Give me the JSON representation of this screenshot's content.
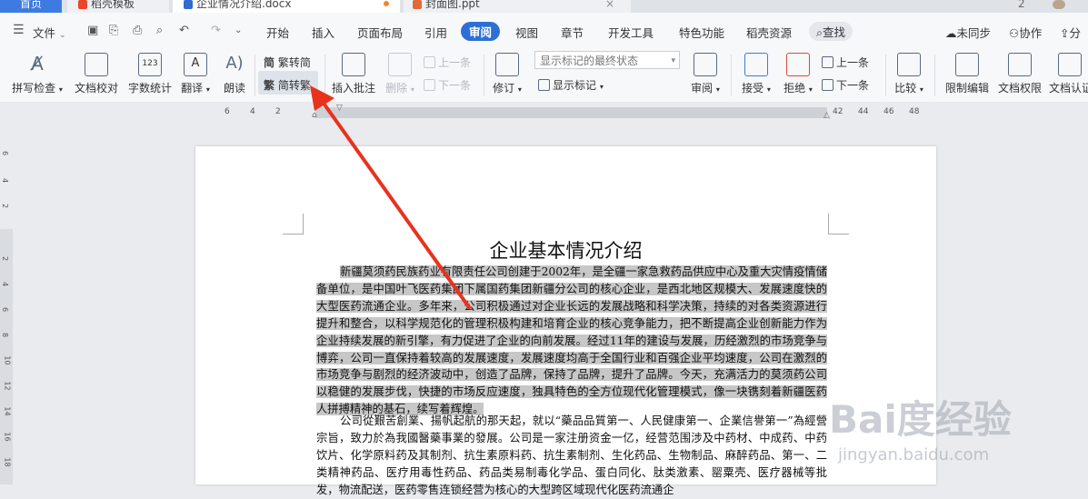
{
  "tabs": [
    {
      "label": "首页",
      "active": false
    },
    {
      "label": "稻壳模板",
      "active": false
    },
    {
      "label": "企业情况介绍.docx",
      "active": true
    },
    {
      "label": "封面图.ppt",
      "active": false
    }
  ],
  "menu": {
    "file_label": "文件",
    "items": [
      "开始",
      "插入",
      "页面布局",
      "引用",
      "审阅",
      "视图",
      "章节",
      "开发工具",
      "特色功能",
      "稻壳资源"
    ],
    "active_item": "审阅",
    "search_label": "查找",
    "sync_label": "未同步",
    "collab_label": "协作",
    "share_label": "分"
  },
  "ribbon": {
    "spell_check": "拼写检查",
    "doc_proof": "文档校对",
    "word_count": "字数统计",
    "translate": "翻译",
    "read_aloud": "朗读",
    "trad_to_simp": "繁转简",
    "simp_to_trad": "简转繁",
    "insert_comment": "插入批注",
    "delete": "删除",
    "prev_comment": "上一条",
    "next_comment": "下一条",
    "revise": "修订",
    "markup_select": "显示标记的最终状态",
    "show_markup": "显示标记",
    "review": "审阅",
    "accept": "接受",
    "reject": "拒绝",
    "prev_change": "上一条",
    "next_change": "下一条",
    "compare": "比较",
    "restrict_edit": "限制编辑",
    "doc_permission": "文档权限",
    "doc_cert": "文档认证"
  },
  "ruler": {
    "left_numbers": [
      "6",
      "4",
      "2"
    ],
    "right_numbers": [
      "42",
      "44",
      "46",
      "48"
    ],
    "vertical_numbers": [
      "6",
      "4",
      "2",
      "2",
      "4",
      "6",
      "8",
      "10",
      "12",
      "14",
      "16",
      "18"
    ]
  },
  "document": {
    "title": "企业基本情况介绍",
    "para1": "新疆莫须药民族药业有限责任公司创建于2002年，是全疆一家急救药品供应中心及重大灾情疫情储备单位，是中国叶飞医药集团下属国药集团新疆分公司的核心企业，是西北地区规模大、发展速度快的大型医药流通企业。多年来，公司积极通过对企业长远的发展战略和科学决策，持续的对各类资源进行提升和整合，以科学规范化的管理积极构建和培育企业的核心竞争能力，把不断提高企业创新能力作为企业持续发展的新引擎，有力促进了企业的向前发展。经过11年的建设与发展，历经激烈的市场竞争与博弈，公司一直保持着较高的发展速度，发展速度均高于全国行业和百强企业平均速度，公司在激烈的市场竞争与剧烈的经济波动中，创造了品牌，保持了品牌，提升了品牌。今天，充满活力的莫须药公司以稳健的发展步伐，快捷的市场反应速度，独具特色的全方位现代化管理模式，像一块镌刻着新疆医药人拼搏精神的基石，续写着辉煌。",
    "para2": "公司從艱苦創業、揚帆起航的那天起，就以“藥品品質第一、人民健康第一、企業信譽第一”為經營宗旨，致力於為我國醫藥事業的發展。公司是一家注册资金一亿，经营范围涉及中药材、中成药、中药饮片、化学原料药及其制剂、抗生素原料药、抗生素制剂、生化药品、生物制品、麻醉药品、第一、二类精神药品、医疗用毒性药品、药品类易制毒化学品、蛋白同化、肽类激素、罂粟壳、医疗器械等批发，物流配送，医药零售连锁经营为核心的大型跨区域现代化医药流通企"
  },
  "watermark": {
    "brand": "Bai度经验",
    "url": "jingyan.baidu.com"
  },
  "colors": {
    "accent": "#2d6fd6",
    "arrow": "#e8321e",
    "selection": "#c7c7c7"
  }
}
